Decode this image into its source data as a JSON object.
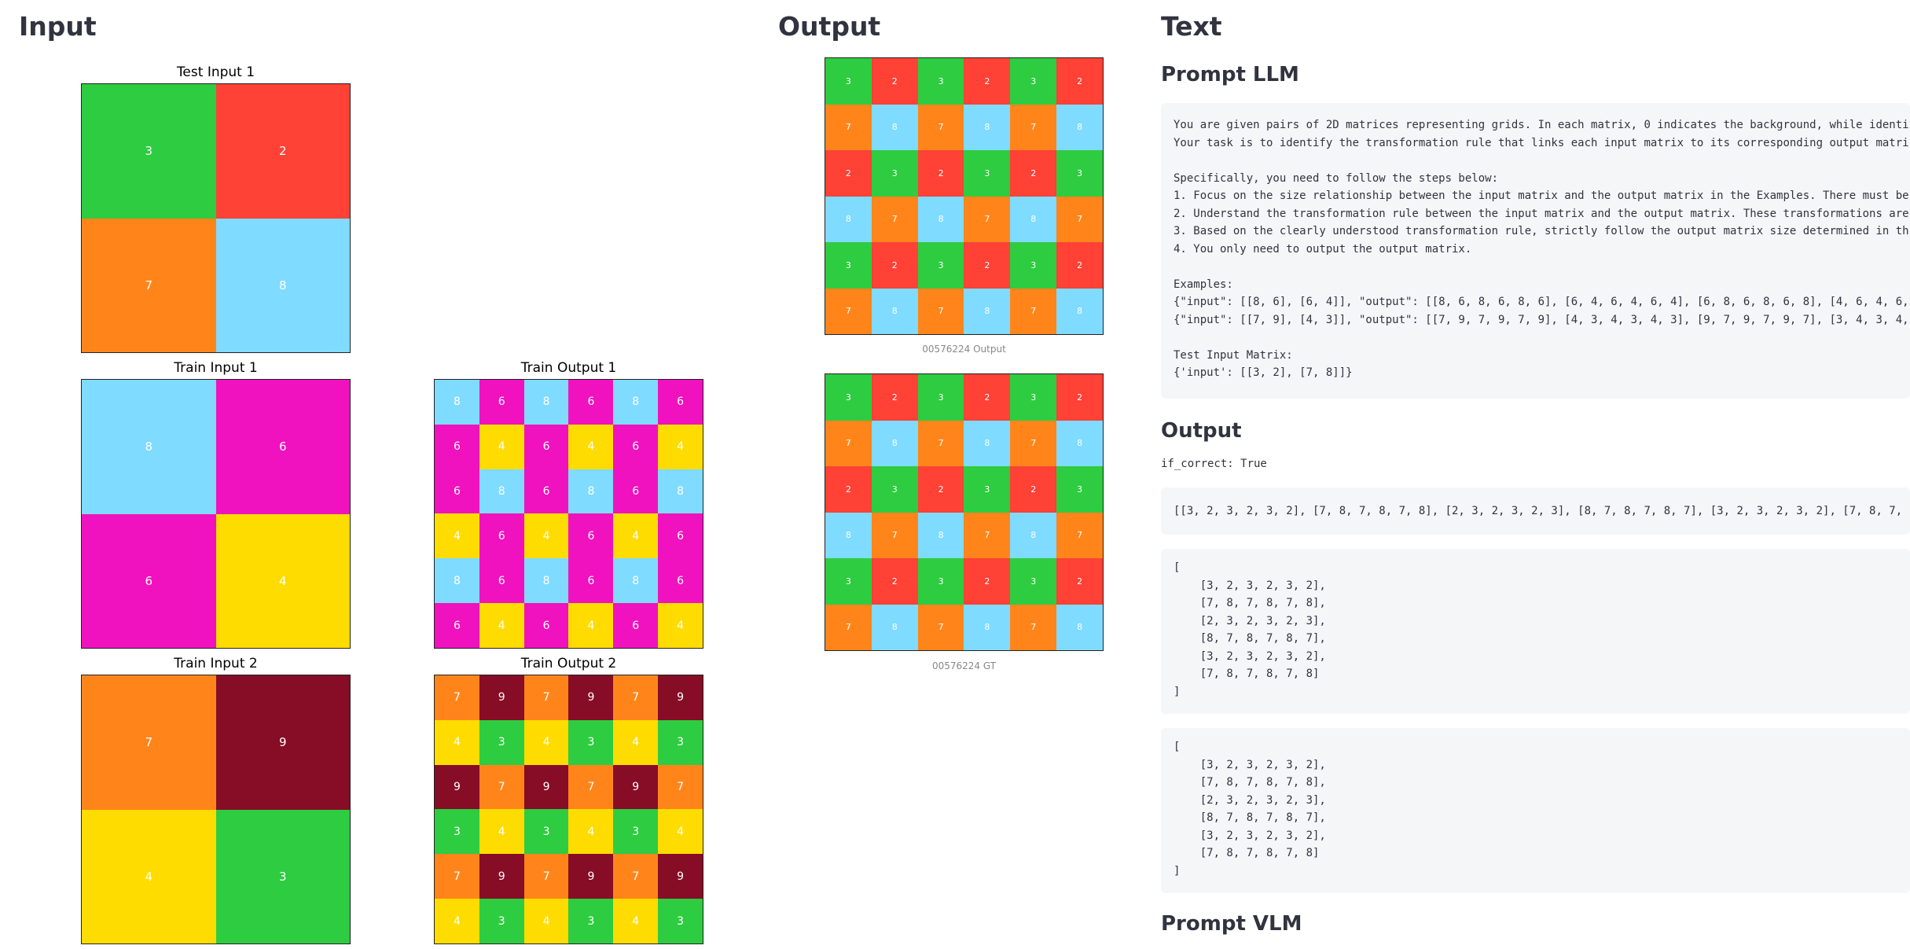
{
  "headings": {
    "input": "Input",
    "output": "Output",
    "text": "Text"
  },
  "palette": {
    "2": "#ff4136",
    "3": "#2ecc40",
    "4": "#ffdc00",
    "6": "#f012be",
    "7": "#ff851b",
    "8": "#7fdbff",
    "9": "#870c25"
  },
  "input_panel": {
    "test_input_1": {
      "caption": "Test Input 1",
      "cells": [
        [
          3,
          2
        ],
        [
          7,
          8
        ]
      ]
    },
    "train_input_1": {
      "caption": "Train Input 1",
      "cells": [
        [
          8,
          6
        ],
        [
          6,
          4
        ]
      ]
    },
    "train_output_1": {
      "caption": "Train Output 1",
      "cells": [
        [
          8,
          6,
          8,
          6,
          8,
          6
        ],
        [
          6,
          4,
          6,
          4,
          6,
          4
        ],
        [
          6,
          8,
          6,
          8,
          6,
          8
        ],
        [
          4,
          6,
          4,
          6,
          4,
          6
        ],
        [
          8,
          6,
          8,
          6,
          8,
          6
        ],
        [
          6,
          4,
          6,
          4,
          6,
          4
        ]
      ]
    },
    "train_input_2": {
      "caption": "Train Input 2",
      "cells": [
        [
          7,
          9
        ],
        [
          4,
          3
        ]
      ]
    },
    "train_output_2": {
      "caption": "Train Output 2",
      "cells": [
        [
          7,
          9,
          7,
          9,
          7,
          9
        ],
        [
          4,
          3,
          4,
          3,
          4,
          3
        ],
        [
          9,
          7,
          9,
          7,
          9,
          7
        ],
        [
          3,
          4,
          3,
          4,
          3,
          4
        ],
        [
          7,
          9,
          7,
          9,
          7,
          9
        ],
        [
          4,
          3,
          4,
          3,
          4,
          3
        ]
      ]
    }
  },
  "output_panel": {
    "output_grid": {
      "caption": "00576224 Output",
      "cells": [
        [
          3,
          2,
          3,
          2,
          3,
          2
        ],
        [
          7,
          8,
          7,
          8,
          7,
          8
        ],
        [
          2,
          3,
          2,
          3,
          2,
          3
        ],
        [
          8,
          7,
          8,
          7,
          8,
          7
        ],
        [
          3,
          2,
          3,
          2,
          3,
          2
        ],
        [
          7,
          8,
          7,
          8,
          7,
          8
        ]
      ]
    },
    "gt_grid": {
      "caption": "00576224 GT",
      "cells": [
        [
          3,
          2,
          3,
          2,
          3,
          2
        ],
        [
          7,
          8,
          7,
          8,
          7,
          8
        ],
        [
          2,
          3,
          2,
          3,
          2,
          3
        ],
        [
          8,
          7,
          8,
          7,
          8,
          7
        ],
        [
          3,
          2,
          3,
          2,
          3,
          2
        ],
        [
          7,
          8,
          7,
          8,
          7,
          8
        ]
      ]
    }
  },
  "text_panel": {
    "prompt_llm_title": "Prompt LLM",
    "prompt_llm_text": "You are given pairs of 2D matrices representing grids. In each matrix, 0 indicates the background, while identi\nYour task is to identify the transformation rule that links each input matrix to its corresponding output matri\n\nSpecifically, you need to follow the steps below:\n1. Focus on the size relationship between the input matrix and the output matrix in the Examples. There must be\n2. Understand the transformation rule between the input matrix and the output matrix. These transformations are\n3. Based on the clearly understood transformation rule, strictly follow the output matrix size determined in th\n4. You only need to output the output matrix.\n\nExamples:\n{\"input\": [[8, 6], [6, 4]], \"output\": [[8, 6, 8, 6, 8, 6], [6, 4, 6, 4, 6, 4], [6, 8, 6, 8, 6, 8], [4, 6, 4, 6,\n{\"input\": [[7, 9], [4, 3]], \"output\": [[7, 9, 7, 9, 7, 9], [4, 3, 4, 3, 4, 3], [9, 7, 9, 7, 9, 7], [3, 4, 3, 4,\n\nTest Input Matrix:\n{'input': [[3, 2], [7, 8]]}",
    "output_title": "Output",
    "if_correct": "if_correct: True",
    "raw_output": "[[3, 2, 3, 2, 3, 2], [7, 8, 7, 8, 7, 8], [2, 3, 2, 3, 2, 3], [8, 7, 8, 7, 8, 7], [3, 2, 3, 2, 3, 2], [7, 8, 7,",
    "parsed_output": "[\n    [3, 2, 3, 2, 3, 2],\n    [7, 8, 7, 8, 7, 8],\n    [2, 3, 2, 3, 2, 3],\n    [8, 7, 8, 7, 8, 7],\n    [3, 2, 3, 2, 3, 2],\n    [7, 8, 7, 8, 7, 8]\n]",
    "ground_truth": "[\n    [3, 2, 3, 2, 3, 2],\n    [7, 8, 7, 8, 7, 8],\n    [2, 3, 2, 3, 2, 3],\n    [8, 7, 8, 7, 8, 7],\n    [3, 2, 3, 2, 3, 2],\n    [7, 8, 7, 8, 7, 8]\n]",
    "prompt_vlm_title": "Prompt VLM"
  }
}
